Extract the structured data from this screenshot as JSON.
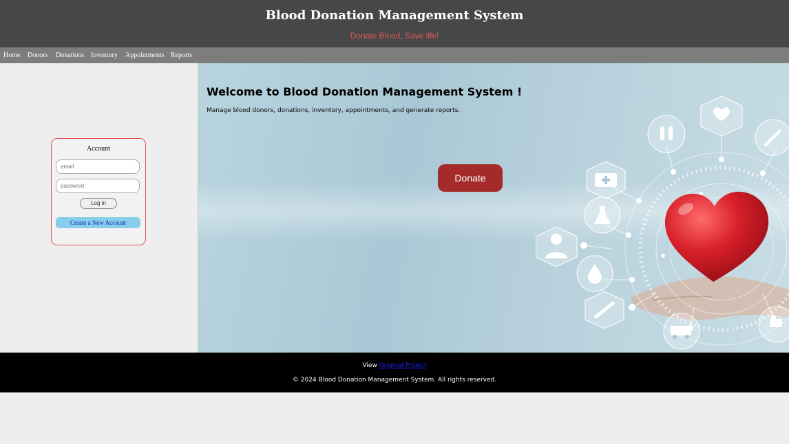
{
  "header": {
    "title": "Blood Donation Management System",
    "tagline": "Donate Blood, Save life!"
  },
  "nav": {
    "items": [
      {
        "label": "Home"
      },
      {
        "label": "Donors"
      },
      {
        "label": "Donations"
      },
      {
        "label": "Inventory"
      },
      {
        "label": "Appointments"
      },
      {
        "label": "Reports"
      }
    ]
  },
  "account": {
    "title": "Account",
    "email_placeholder": "email",
    "password_placeholder": "password",
    "login_label": "Log in",
    "create_label": "Create a New Account"
  },
  "hero": {
    "heading": "Welcome to Blood Donation Management System !",
    "subtext": "Manage blood donors, donations, inventory, appointments, and generate reports.",
    "donate_label": "Donate",
    "illustration_icons": [
      "heart-monitor-icon",
      "test-tubes-icon",
      "syringe-icon",
      "first-aid-kit-icon",
      "flask-icon",
      "doctor-icon",
      "blood-drop-icon",
      "ambulance-icon",
      "heart-icon"
    ]
  },
  "footer": {
    "view_prefix": "View ",
    "link_label": "Original Project",
    "copyright": "© 2024 Blood Donation Management System. All rights reserved."
  },
  "colors": {
    "header_bg": "#474747",
    "nav_bg": "#7d7d7d",
    "tagline": "#e05a5a",
    "donate_bg": "#a52a2a",
    "create_bg": "#87ceeb",
    "footer_bg": "#000000"
  }
}
